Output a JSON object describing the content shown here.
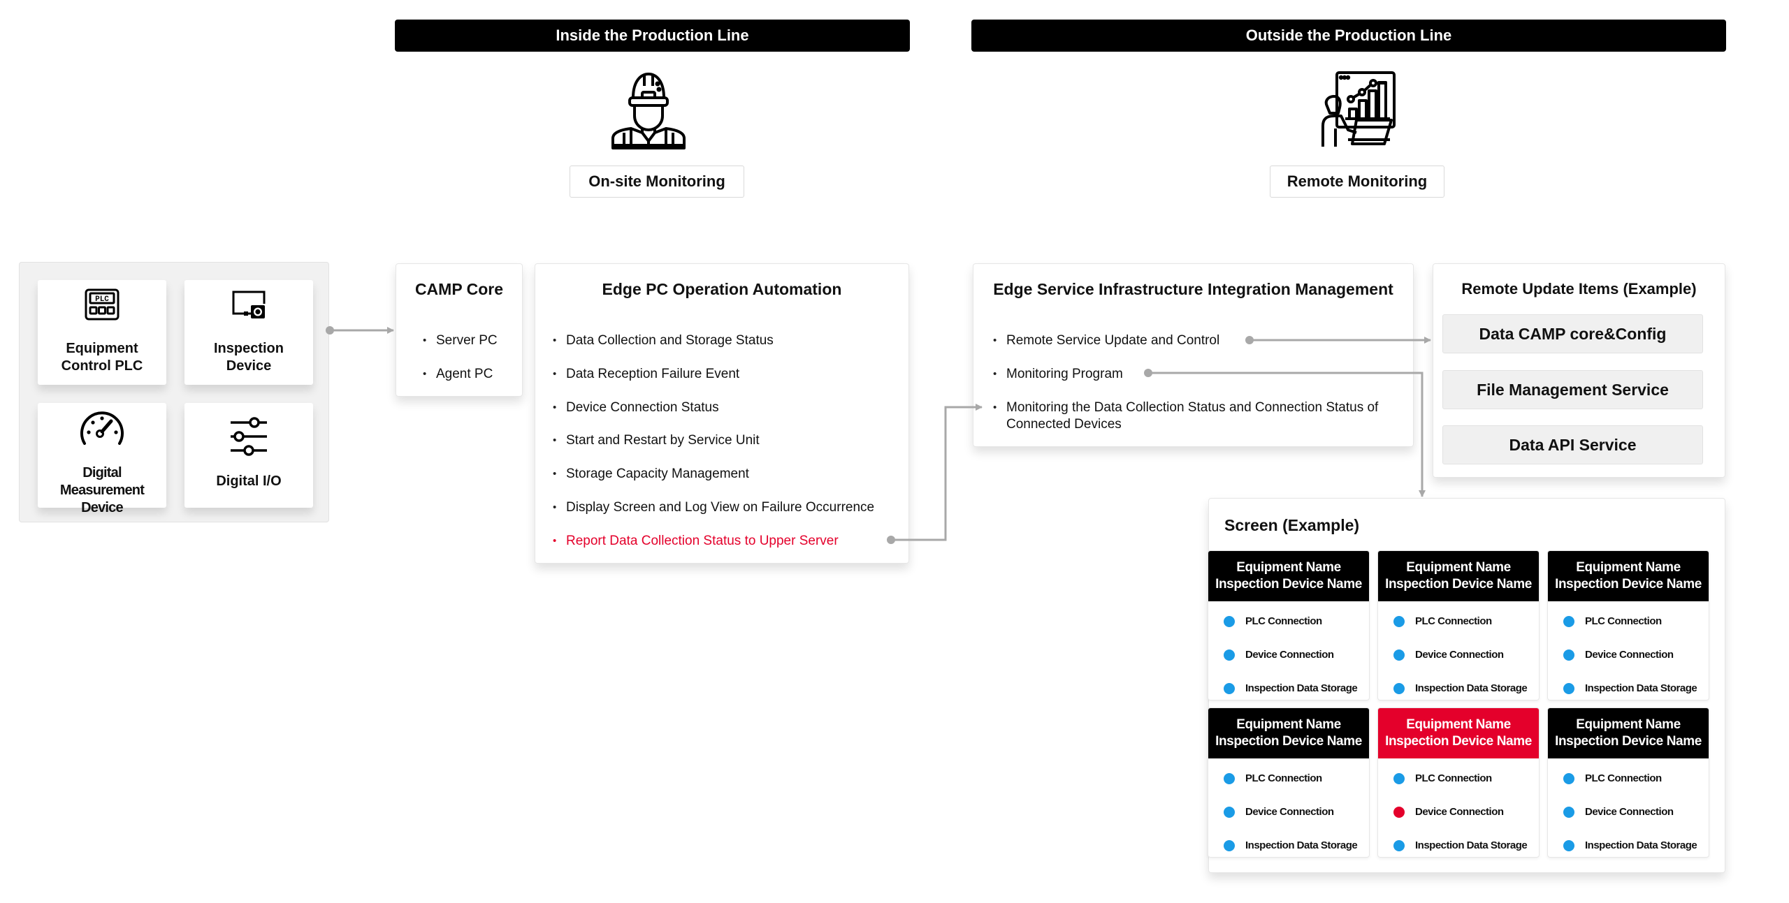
{
  "zones": {
    "inside": {
      "label": "Inside the Production Line",
      "icon": "worker-icon",
      "mode_label": "On-site Monitoring"
    },
    "outside": {
      "label": "Outside the Production Line",
      "icon": "remote-analyst-icon",
      "mode_label": "Remote Monitoring"
    }
  },
  "devices": [
    {
      "icon": "plc-icon",
      "label_line1": "Equipment",
      "label_line2": "Control PLC"
    },
    {
      "icon": "inspection-device-icon",
      "label_line1": "Inspection",
      "label_line2": "Device"
    },
    {
      "icon": "gauge-icon",
      "label_line1": "Digital",
      "label_line2": "Measurement Device"
    },
    {
      "icon": "sliders-icon",
      "label_line1": "Digital I/O",
      "label_line2": ""
    }
  ],
  "camp_core": {
    "title": "CAMP Core",
    "items": [
      "Server PC",
      "Agent PC"
    ]
  },
  "edge_pc": {
    "title": "Edge PC Operation Automation",
    "items": [
      "Data Collection and Storage Status",
      "Data Reception Failure Event",
      "Device Connection Status",
      "Start and Restart by Service Unit",
      "Storage Capacity Management",
      "Display Screen and Log View on Failure Occurrence",
      "Report Data Collection Status to Upper Server"
    ],
    "highlight_index": 6
  },
  "edge_service": {
    "title": "Edge Service Infrastructure Integration Management",
    "items": [
      "Remote Service Update and Control",
      "Monitoring Program",
      "Monitoring the Data Collection Status and Connection Status of Connected Devices"
    ]
  },
  "remote_update": {
    "title": "Remote Update Items (Example)",
    "items": [
      "Data CAMP core&Config",
      "File Management Service",
      "Data API Service"
    ]
  },
  "screen_example": {
    "title": "Screen (Example)",
    "status_labels": [
      "PLC Connection",
      "Device Connection",
      "Inspection Data Storage"
    ],
    "cards": [
      {
        "line1": "Equipment Name",
        "line2": "Inspection Device Name",
        "alert": false,
        "status": [
          "ok",
          "ok",
          "ok"
        ]
      },
      {
        "line1": "Equipment Name",
        "line2": "Inspection Device Name",
        "alert": false,
        "status": [
          "ok",
          "ok",
          "ok"
        ]
      },
      {
        "line1": "Equipment Name",
        "line2": "Inspection Device Name",
        "alert": false,
        "status": [
          "ok",
          "ok",
          "ok"
        ]
      },
      {
        "line1": "Equipment Name",
        "line2": "Inspection Device Name",
        "alert": false,
        "status": [
          "ok",
          "ok",
          "ok"
        ]
      },
      {
        "line1": "Equipment Name",
        "line2": "Inspection Device Name",
        "alert": true,
        "status": [
          "ok",
          "error",
          "ok"
        ]
      },
      {
        "line1": "Equipment Name",
        "line2": "Inspection Device Name",
        "alert": false,
        "status": [
          "ok",
          "ok",
          "ok"
        ]
      }
    ]
  },
  "colors": {
    "accent_red": "#e4002b",
    "status_ok": "#1a9be6",
    "status_error": "#e4002b",
    "connector": "#a8a8a8",
    "header_black": "#000000"
  }
}
